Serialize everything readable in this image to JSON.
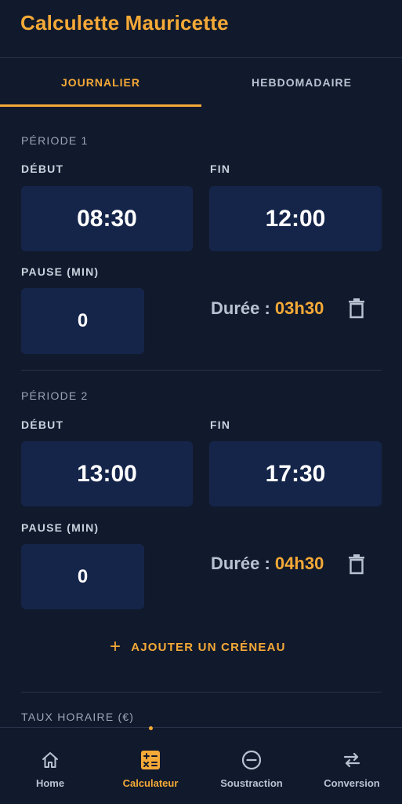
{
  "app": {
    "title": "Calculette Mauricette"
  },
  "tabs": [
    {
      "label": "JOURNALIER",
      "active": true
    },
    {
      "label": "HEBDOMADAIRE",
      "active": false
    }
  ],
  "periods": [
    {
      "title": "PÉRIODE 1",
      "start_label": "DÉBUT",
      "start": "08:30",
      "end_label": "FIN",
      "end": "12:00",
      "pause_label": "PAUSE (MIN)",
      "pause": "0",
      "duration_label": "Durée : ",
      "duration": "03h30",
      "delete_icon": "trash-icon"
    },
    {
      "title": "PÉRIODE 2",
      "start_label": "DÉBUT",
      "start": "13:00",
      "end_label": "FIN",
      "end": "17:30",
      "pause_label": "PAUSE (MIN)",
      "pause": "0",
      "duration_label": "Durée : ",
      "duration": "04h30",
      "delete_icon": "trash-icon"
    }
  ],
  "add_slot": {
    "icon": "plus-icon",
    "label": "AJOUTER UN CRÉNEAU"
  },
  "hourly_rate": {
    "label": "TAUX HORAIRE (€)"
  },
  "bottom_nav": [
    {
      "label": "Home",
      "icon": "home-icon",
      "active": false
    },
    {
      "label": "Calculateur",
      "icon": "calculator-icon",
      "active": true
    },
    {
      "label": "Soustraction",
      "icon": "minus-circle-icon",
      "active": false
    },
    {
      "label": "Conversion",
      "icon": "swap-arrows-icon",
      "active": false
    }
  ],
  "colors": {
    "accent": "#f5a937",
    "background": "#111a2c",
    "field": "#15254a",
    "muted": "#b8c2d1"
  }
}
